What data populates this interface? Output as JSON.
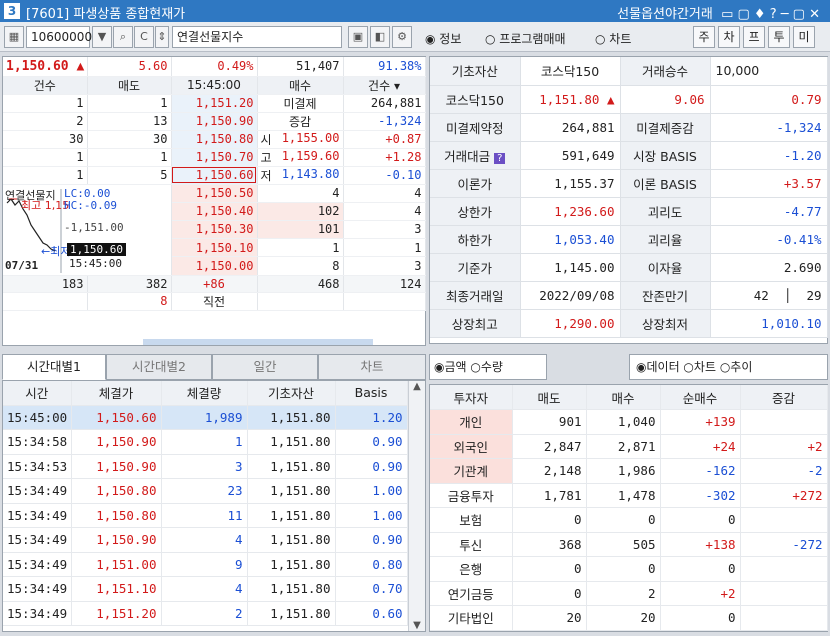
{
  "window": {
    "number": "3",
    "title": "[7601] 파생상품 종합현재가",
    "right_title": "선물옵션야간거래"
  },
  "toolbar": {
    "code": "10600000",
    "name": "연결선물지수",
    "radios": [
      "정보",
      "프로그램매매",
      "차트"
    ],
    "buttons": [
      "주",
      "차",
      "프",
      "투",
      "미"
    ]
  },
  "quote": {
    "price": "1,150.60",
    "change": "5.60",
    "rate": "0.49%",
    "volume": "51,407",
    "ratio": "91.38%"
  },
  "book": {
    "headers": [
      "건수",
      "매도",
      "15:45:00",
      "매수",
      "건수"
    ],
    "asks": [
      {
        "cnt": "1",
        "qty": "1",
        "price": "1,151.20"
      },
      {
        "cnt": "2",
        "qty": "13",
        "price": "1,150.90"
      },
      {
        "cnt": "30",
        "qty": "30",
        "price": "1,150.80"
      },
      {
        "cnt": "1",
        "qty": "1",
        "price": "1,150.70"
      },
      {
        "cnt": "1",
        "qty": "5",
        "price": "1,150.60"
      }
    ],
    "side_info": [
      {
        "label": "미결제",
        "val": "264,881"
      },
      {
        "label": "증감",
        "val": "-1,324"
      }
    ],
    "ohl": [
      {
        "label": "시",
        "price": "1,155.00",
        "chg": "+0.87"
      },
      {
        "label": "고",
        "price": "1,159.60",
        "chg": "+1.28"
      },
      {
        "label": "저",
        "price": "1,143.80",
        "chg": "-0.10"
      }
    ],
    "bids": [
      {
        "price": "1,150.50",
        "qty": "4",
        "cnt": "4"
      },
      {
        "price": "1,150.40",
        "qty": "102",
        "cnt": "4"
      },
      {
        "price": "1,150.30",
        "qty": "101",
        "cnt": "3"
      },
      {
        "price": "1,150.10",
        "qty": "1",
        "cnt": "1"
      },
      {
        "price": "1,150.00",
        "qty": "8",
        "cnt": "3"
      }
    ],
    "mini_chart": {
      "title": "연결선물지",
      "hi_label": "최고 1,15",
      "lc": "LC:0.00",
      "hc": "HC:-0.09",
      "mid": "-1,151.00",
      "lo_label": "←최저",
      "cur": "1,150.60",
      "time": "15:45:00",
      "date": "07/31"
    },
    "totals": {
      "ask_cnt": "183",
      "ask_qty": "382",
      "diff": "+86",
      "bid_qty": "468",
      "bid_cnt": "124"
    },
    "last_row": {
      "qty": "8",
      "label": "직전"
    }
  },
  "info": [
    [
      "기초자산",
      "코스닥150",
      "거래승수",
      "10,000"
    ],
    [
      "코스닥150",
      "1,151.80",
      "9.06",
      "0.79"
    ],
    [
      "미결제약정",
      "264,881",
      "미결제증감",
      "-1,324"
    ],
    [
      "거래대금",
      "591,649",
      "시장 BASIS",
      "-1.20"
    ],
    [
      "이론가",
      "1,155.37",
      "이론 BASIS",
      "+3.57"
    ],
    [
      "상한가",
      "1,236.60",
      "괴리도",
      "-4.77"
    ],
    [
      "하한가",
      "1,053.40",
      "괴리율",
      "-0.41%"
    ],
    [
      "기준가",
      "1,145.00",
      "이자율",
      "2.690"
    ],
    [
      "최종거래일",
      "2022/09/08",
      "잔존만기",
      "42",
      "29"
    ],
    [
      "상장최고",
      "1,290.00",
      "상장최저",
      "1,010.10"
    ]
  ],
  "tabs": [
    "시간대별1",
    "시간대별2",
    "일간",
    "차트"
  ],
  "trades": {
    "headers": [
      "시간",
      "체결가",
      "체결량",
      "기초자산",
      "Basis"
    ],
    "rows": [
      [
        "15:45:00",
        "1,150.60",
        "1,989",
        "1,151.80",
        "1.20"
      ],
      [
        "15:34:58",
        "1,150.90",
        "1",
        "1,151.80",
        "0.90"
      ],
      [
        "15:34:53",
        "1,150.90",
        "3",
        "1,151.80",
        "0.90"
      ],
      [
        "15:34:49",
        "1,150.80",
        "23",
        "1,151.80",
        "1.00"
      ],
      [
        "15:34:49",
        "1,150.80",
        "11",
        "1,151.80",
        "1.00"
      ],
      [
        "15:34:49",
        "1,150.90",
        "4",
        "1,151.80",
        "0.90"
      ],
      [
        "15:34:49",
        "1,151.00",
        "9",
        "1,151.80",
        "0.80"
      ],
      [
        "15:34:49",
        "1,151.10",
        "4",
        "1,151.80",
        "0.70"
      ],
      [
        "15:34:49",
        "1,151.20",
        "2",
        "1,151.80",
        "0.60"
      ]
    ]
  },
  "investor": {
    "radios_left": [
      "금액",
      "수량"
    ],
    "radios_right": [
      "데이터",
      "차트",
      "추이"
    ],
    "headers": [
      "투자자",
      "매도",
      "매수",
      "순매수",
      "증감"
    ],
    "rows": [
      [
        "개인",
        "901",
        "1,040",
        "+139",
        ""
      ],
      [
        "외국인",
        "2,847",
        "2,871",
        "+24",
        "+2"
      ],
      [
        "기관계",
        "2,148",
        "1,986",
        "-162",
        "-2"
      ],
      [
        "금융투자",
        "1,781",
        "1,478",
        "-302",
        "+272"
      ],
      [
        "보험",
        "0",
        "0",
        "0",
        ""
      ],
      [
        "투신",
        "368",
        "505",
        "+138",
        "-272"
      ],
      [
        "은행",
        "0",
        "0",
        "0",
        ""
      ],
      [
        "연기금등",
        "0",
        "2",
        "+2",
        ""
      ],
      [
        "기타법인",
        "20",
        "20",
        "0",
        ""
      ]
    ]
  },
  "colors": {
    "up": "#d21a1a",
    "down": "#1b4fd4",
    "title_bar": "#2f78c2"
  }
}
